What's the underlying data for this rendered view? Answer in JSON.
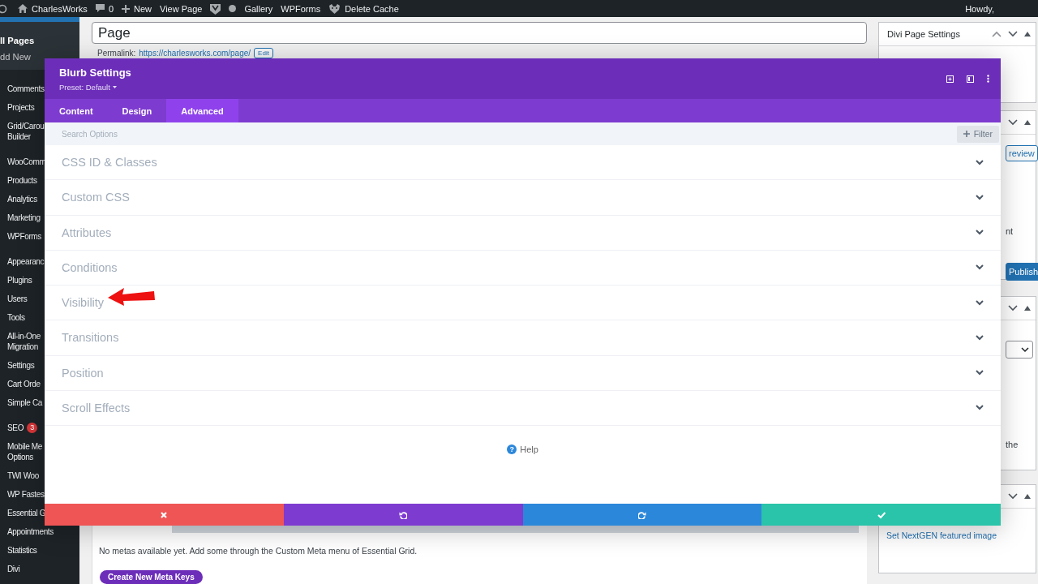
{
  "admin_bar": {
    "items": [
      {
        "kind": "logo"
      },
      {
        "kind": "home",
        "label": "CharlesWorks"
      },
      {
        "kind": "comments",
        "label": "0"
      },
      {
        "kind": "new",
        "label": "New"
      },
      {
        "kind": "text",
        "label": "View Page"
      },
      {
        "kind": "shield"
      },
      {
        "kind": "dot"
      },
      {
        "kind": "text",
        "label": "Gallery"
      },
      {
        "kind": "text",
        "label": "WPForms"
      },
      {
        "kind": "cache",
        "label": "Delete Cache"
      }
    ],
    "greeting": "Howdy,"
  },
  "sidebar": {
    "submenu": [
      {
        "label": "ll Pages",
        "selected": true
      },
      {
        "label": "dd New",
        "selected": false
      }
    ],
    "groups": [
      [
        {
          "lines": [
            "Comments"
          ]
        },
        {
          "lines": [
            "Projects"
          ]
        },
        {
          "lines": [
            "Grid/Carou",
            "Builder"
          ]
        }
      ],
      [
        {
          "lines": [
            "WooComm"
          ]
        },
        {
          "lines": [
            "Products"
          ]
        },
        {
          "lines": [
            "Analytics"
          ]
        },
        {
          "lines": [
            "Marketing"
          ]
        },
        {
          "lines": [
            "WPForms"
          ]
        }
      ],
      [
        {
          "lines": [
            "Appearanc"
          ]
        },
        {
          "lines": [
            "Plugins"
          ]
        },
        {
          "lines": [
            "Users"
          ]
        },
        {
          "lines": [
            "Tools"
          ]
        },
        {
          "lines": [
            "All-in-One",
            "Migration"
          ]
        },
        {
          "lines": [
            "Settings"
          ]
        },
        {
          "lines": [
            "Cart Orde"
          ]
        },
        {
          "lines": [
            "Simple Ca"
          ]
        }
      ],
      [
        {
          "lines": [
            "SEO"
          ],
          "badge": "3"
        },
        {
          "lines": [
            "Mobile Me",
            "Options"
          ]
        },
        {
          "lines": [
            "TWI Woo"
          ]
        },
        {
          "lines": [
            "WP Fastes"
          ]
        },
        {
          "lines": [
            "Essential G"
          ]
        },
        {
          "lines": [
            "Appointments"
          ]
        },
        {
          "lines": [
            "Statistics"
          ]
        },
        {
          "lines": [
            "Divi"
          ]
        }
      ]
    ]
  },
  "editor": {
    "title_value": "Page",
    "permalink_label": "Permalink:",
    "permalink_url": "https://charlesworks.com/page/",
    "edit_button": "Edit",
    "meta_note": "No metas available yet. Add some through the Custom Meta menu of Essential Grid.",
    "meta_button": "Create New Meta Keys"
  },
  "side_panels": [
    {
      "title": "Divi Page Settings"
    },
    {
      "items": [
        {
          "kind": "button",
          "label": "review"
        },
        {
          "kind": "text",
          "label": "nt"
        },
        {
          "kind": "primary",
          "label": "Publish"
        }
      ]
    },
    {
      "items": [
        {
          "kind": "select"
        },
        {
          "kind": "text",
          "label": "the"
        }
      ]
    },
    {
      "items": [
        {
          "kind": "link",
          "label": "Set NextGEN featured image"
        }
      ]
    }
  ],
  "modal": {
    "title": "Blurb Settings",
    "preset": "Preset: Default",
    "tabs": [
      {
        "label": "Content",
        "selected": false
      },
      {
        "label": "Design",
        "selected": false
      },
      {
        "label": "Advanced",
        "selected": true
      }
    ],
    "search": {
      "placeholder": "Search Options"
    },
    "filter": "Filter",
    "groups": [
      {
        "label": "CSS ID & Classes",
        "expanded": false
      },
      {
        "label": "Custom CSS",
        "expanded": false
      },
      {
        "label": "Attributes",
        "expanded": false
      },
      {
        "label": "Conditions",
        "expanded": false
      },
      {
        "label": "Visibility",
        "expanded": false,
        "annotated": true
      },
      {
        "label": "Transitions",
        "expanded": false
      },
      {
        "label": "Position",
        "expanded": false
      },
      {
        "label": "Scroll Effects",
        "expanded": false
      }
    ],
    "help_icon": "?",
    "help": "Help",
    "footer": [
      {
        "kind": "discard"
      },
      {
        "kind": "undo"
      },
      {
        "kind": "redo"
      },
      {
        "kind": "save"
      }
    ]
  }
}
